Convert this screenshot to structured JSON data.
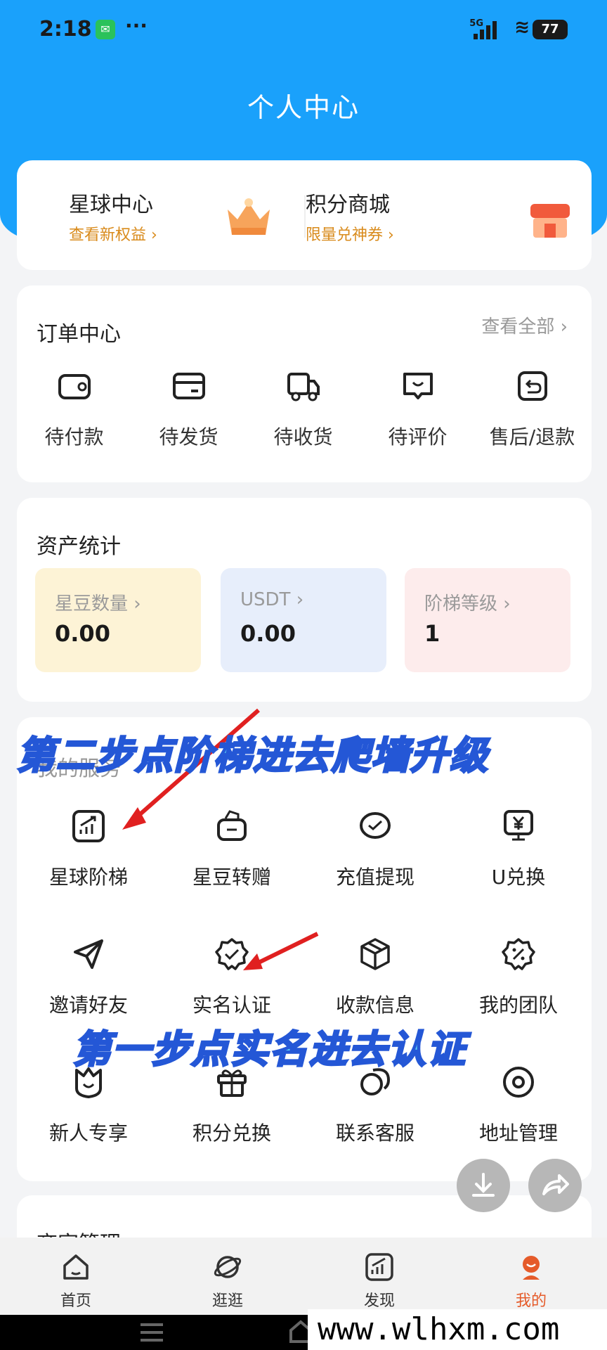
{
  "status_bar": {
    "time": "2:18",
    "network": "5G",
    "battery": "77"
  },
  "header": {
    "title": "个人中心"
  },
  "top_cards": [
    {
      "title": "星球中心",
      "sub": "查看新权益 ›"
    },
    {
      "title": "积分商城",
      "sub": "限量兑神券 ›"
    }
  ],
  "orders": {
    "title": "订单中心",
    "see_all": "查看全部 ›",
    "items": [
      {
        "label": "待付款",
        "icon": "wallet-icon"
      },
      {
        "label": "待发货",
        "icon": "box-icon"
      },
      {
        "label": "待收货",
        "icon": "truck-icon"
      },
      {
        "label": "待评价",
        "icon": "comment-icon"
      },
      {
        "label": "售后/退款",
        "icon": "return-icon"
      }
    ]
  },
  "assets": {
    "title": "资产统计",
    "items": [
      {
        "label": "星豆数量 ›",
        "value": "0.00",
        "bg": "#fdf3d6"
      },
      {
        "label": "USDT ›",
        "value": "0.00",
        "bg": "#e7eefb"
      },
      {
        "label": "阶梯等级 ›",
        "value": "1",
        "bg": "#fdecec"
      }
    ]
  },
  "services": {
    "title": "我的服务",
    "items": [
      {
        "label": "星球阶梯",
        "icon": "chart-up-icon"
      },
      {
        "label": "星豆转赠",
        "icon": "gift-bag-icon"
      },
      {
        "label": "充值提现",
        "icon": "check-chat-icon"
      },
      {
        "label": "U兑换",
        "icon": "yen-monitor-icon"
      },
      {
        "label": "邀请好友",
        "icon": "send-icon"
      },
      {
        "label": "实名认证",
        "icon": "verified-badge-icon"
      },
      {
        "label": "收款信息",
        "icon": "package-icon"
      },
      {
        "label": "我的团队",
        "icon": "discount-icon"
      },
      {
        "label": "新人专享",
        "icon": "shield-smile-icon"
      },
      {
        "label": "积分兑换",
        "icon": "gift-icon"
      },
      {
        "label": "联系客服",
        "icon": "chat-icon"
      },
      {
        "label": "地址管理",
        "icon": "location-icon"
      }
    ]
  },
  "annotations": {
    "step2": "第二步点阶梯进去爬墙升级",
    "step1": "第一步点实名进去认证"
  },
  "merchant": {
    "title": "商家管理"
  },
  "tabs": [
    {
      "label": "首页",
      "icon": "home-icon"
    },
    {
      "label": "逛逛",
      "icon": "planet-icon"
    },
    {
      "label": "发现",
      "icon": "chart-icon"
    },
    {
      "label": "我的",
      "icon": "profile-icon",
      "active": true
    }
  ],
  "watermark": "www.wlhxm.com",
  "colors": {
    "primary": "#1aa1fb",
    "accent": "#d98b1c",
    "annotation": "#5fd2f5",
    "arrow": "#e02020"
  }
}
